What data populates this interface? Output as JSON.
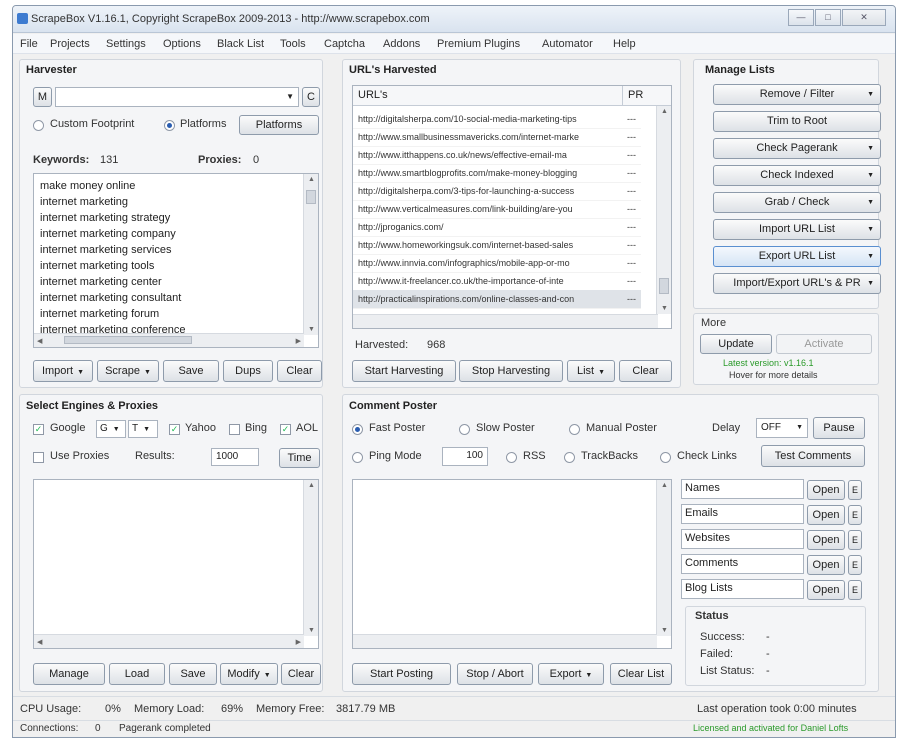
{
  "window": {
    "title": "ScrapeBox V1.16.1, Copyright ScrapeBox 2009-2013 - http://www.scrapebox.com"
  },
  "menu": [
    "File",
    "Projects",
    "Settings",
    "Options",
    "Black List",
    "Tools",
    "Captcha",
    "Addons",
    "Premium Plugins",
    "Automator",
    "Help"
  ],
  "harvester": {
    "title": "Harvester",
    "m_button": "M",
    "c_button": "C",
    "custom_footprint": "Custom Footprint",
    "platforms_radio": "Platforms",
    "platforms_button": "Platforms",
    "keywords_label": "Keywords:",
    "keywords_count": "131",
    "proxies_label": "Proxies:",
    "proxies_count": "0",
    "keywords": [
      "make money online",
      "internet marketing",
      "internet marketing strategy",
      "internet marketing company",
      "internet marketing services",
      "internet marketing tools",
      "internet marketing center",
      "internet marketing consultant",
      "internet marketing forum",
      "internet marketing conference"
    ],
    "buttons": {
      "import": "Import",
      "scrape": "Scrape",
      "save": "Save",
      "dups": "Dups",
      "clear": "Clear"
    }
  },
  "urls_harvested": {
    "title": "URL's Harvested",
    "col_url": "URL's",
    "col_pr": "PR",
    "rows": [
      {
        "url": "http://digitalsherpa.com/10-social-media-marketing-tips",
        "pr": "---"
      },
      {
        "url": "http://www.smallbusinessmavericks.com/internet-marke",
        "pr": "---"
      },
      {
        "url": "http://www.itthappens.co.uk/news/effective-email-ma",
        "pr": "---"
      },
      {
        "url": "http://www.smartblogprofits.com/make-money-blogging",
        "pr": "---"
      },
      {
        "url": "http://digitalsherpa.com/3-tips-for-launching-a-success",
        "pr": "---"
      },
      {
        "url": "http://www.verticalmeasures.com/link-building/are-you",
        "pr": "---"
      },
      {
        "url": "http://jproganics.com/",
        "pr": "---"
      },
      {
        "url": "http://www.homeworkingsuk.com/internet-based-sales",
        "pr": "---"
      },
      {
        "url": "http://www.innvia.com/infographics/mobile-app-or-mo",
        "pr": "---"
      },
      {
        "url": "http://www.it-freelancer.co.uk/the-importance-of-inte",
        "pr": "---"
      },
      {
        "url": "http://practicalinspirations.com/online-classes-and-con",
        "pr": "---"
      }
    ],
    "harvested_label": "Harvested:",
    "harvested_count": "968",
    "buttons": {
      "start": "Start Harvesting",
      "stop": "Stop Harvesting",
      "list": "List",
      "clear": "Clear"
    }
  },
  "manage_lists": {
    "title": "Manage Lists",
    "buttons": [
      "Remove / Filter",
      "Trim to Root",
      "Check Pagerank",
      "Check Indexed",
      "Grab / Check",
      "Import URL List",
      "Export URL List",
      "Import/Export URL's & PR"
    ],
    "has_arrow": [
      true,
      false,
      true,
      true,
      true,
      true,
      true,
      true
    ],
    "more_title": "More",
    "update": "Update",
    "activate": "Activate",
    "latest_version": "Latest version: v1.16.1",
    "hover_note": "Hover for more details"
  },
  "engines": {
    "title": "Select Engines & Proxies",
    "google": "Google",
    "g_select": "G",
    "t_select": "T",
    "yahoo": "Yahoo",
    "bing": "Bing",
    "aol": "AOL",
    "use_proxies": "Use Proxies",
    "results_label": "Results:",
    "results_value": "1000",
    "time_button": "Time",
    "buttons": {
      "manage": "Manage",
      "load": "Load",
      "save": "Save",
      "modify": "Modify",
      "clear": "Clear"
    }
  },
  "comment_poster": {
    "title": "Comment Poster",
    "fast": "Fast Poster",
    "slow": "Slow Poster",
    "manual": "Manual Poster",
    "delay_label": "Delay",
    "delay_value": "OFF",
    "pause": "Pause",
    "ping": "Ping Mode",
    "ping_value": "100",
    "rss": "RSS",
    "trackbacks": "TrackBacks",
    "check_links": "Check Links",
    "test_comments": "Test Comments",
    "fields": [
      "Names",
      "Emails",
      "Websites",
      "Comments",
      "Blog Lists"
    ],
    "open": "Open",
    "e_btn": "E",
    "status_title": "Status",
    "success_label": "Success:",
    "success_value": "-",
    "failed_label": "Failed:",
    "failed_value": "-",
    "list_status_label": "List Status:",
    "list_status_value": "-",
    "buttons": {
      "start": "Start Posting",
      "stop": "Stop / Abort",
      "export": "Export",
      "clear": "Clear List"
    }
  },
  "statusbar": {
    "cpu_label": "CPU Usage:",
    "cpu_value": "0%",
    "mem_load_label": "Memory Load:",
    "mem_load_value": "69%",
    "mem_free_label": "Memory Free:",
    "mem_free_value": "3817.79 MB",
    "last_op": "Last operation took 0:00 minutes",
    "connections_label": "Connections:",
    "connections_value": "0",
    "pagerank_status": "Pagerank completed",
    "licensed": "Licensed and activated for Daniel Lofts"
  },
  "colors": {
    "accent": "#2a5db0",
    "green": "#2a9a2a",
    "border": "#8e9bab"
  }
}
